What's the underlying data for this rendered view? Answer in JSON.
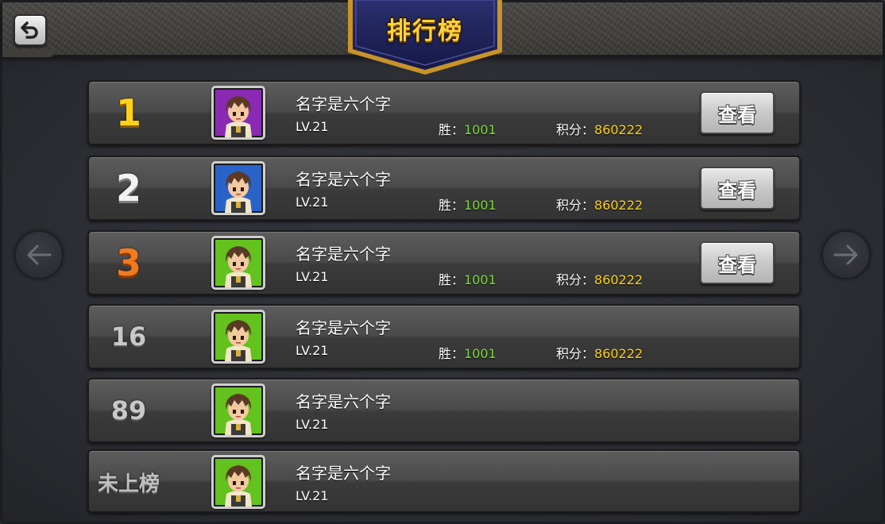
{
  "header": {
    "title": "排行榜",
    "back_icon": "back-arrow-icon"
  },
  "nav": {
    "prev_icon": "arrow-left-icon",
    "next_icon": "arrow-right-icon"
  },
  "colors": {
    "gold": "#ffd21a",
    "silver": "#f2f2f2",
    "bronze": "#f07a1e",
    "wins_value": "#7ddb3a",
    "score_value": "#ffd21a",
    "avatar_purple": "#8a2ab4",
    "avatar_blue": "#2a63c8",
    "avatar_green": "#63c21e"
  },
  "rows": [
    {
      "rank": "1",
      "name": "名字是六个字",
      "level": "LV.21",
      "wins_label": "胜：",
      "wins": "1001",
      "score_label": "积分：",
      "score": "860222",
      "button": "查看",
      "avatar_bg": "purple"
    },
    {
      "rank": "2",
      "name": "名字是六个字",
      "level": "LV.21",
      "wins_label": "胜：",
      "wins": "1001",
      "score_label": "积分：",
      "score": "860222",
      "button": "查看",
      "avatar_bg": "blue"
    },
    {
      "rank": "3",
      "name": "名字是六个字",
      "level": "LV.21",
      "wins_label": "胜：",
      "wins": "1001",
      "score_label": "积分：",
      "score": "860222",
      "button": "查看",
      "avatar_bg": "green"
    },
    {
      "rank": "16",
      "name": "名字是六个字",
      "level": "LV.21",
      "wins_label": "胜：",
      "wins": "1001",
      "score_label": "积分：",
      "score": "860222",
      "avatar_bg": "green"
    },
    {
      "rank": "89",
      "name": "名字是六个字",
      "level": "LV.21",
      "avatar_bg": "green"
    },
    {
      "rank": "未上榜",
      "name": "名字是六个字",
      "level": "LV.21",
      "avatar_bg": "green"
    }
  ]
}
